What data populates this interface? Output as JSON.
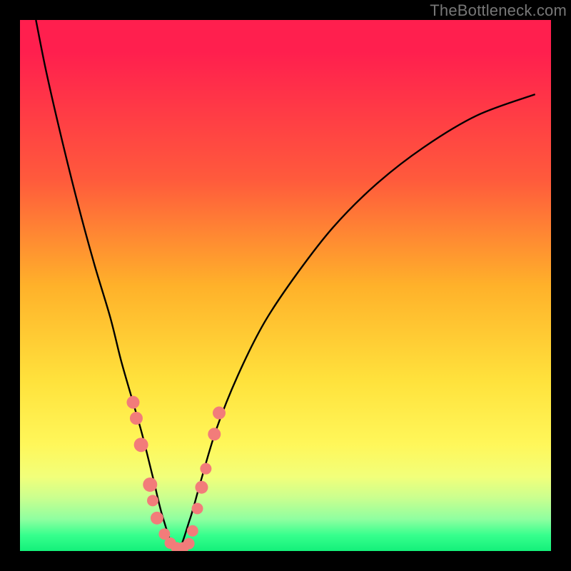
{
  "watermark": "TheBottleneck.com",
  "colors": {
    "frame": "#000000",
    "curve": "#000000",
    "marker": "#f27c7a",
    "marker_stroke": "#c95f5c"
  },
  "chart_data": {
    "type": "line",
    "title": "",
    "xlabel": "",
    "ylabel": "",
    "xlim": [
      0,
      100
    ],
    "ylim": [
      0,
      100
    ],
    "curve": {
      "comment": "approximate V-shaped bottleneck curve; x is horizontal % across plot, y is % bottleneck (100=top/red, 0=bottom/green)",
      "x": [
        3,
        5,
        8,
        11,
        14,
        17,
        19,
        21,
        23,
        25,
        27,
        29.5,
        32,
        34,
        37,
        41,
        46,
        52,
        59,
        67,
        76,
        86,
        97
      ],
      "y": [
        100,
        90,
        77,
        65,
        54,
        44,
        36,
        29,
        22,
        14,
        6,
        0,
        6,
        13,
        23,
        33,
        43,
        52,
        61,
        69,
        76,
        82,
        86
      ]
    },
    "markers": {
      "comment": "salmon dots overlaying the curve near the bottom; each item = [x%, y%, radius_px]",
      "points": [
        [
          21.3,
          28,
          9
        ],
        [
          21.9,
          25,
          9
        ],
        [
          22.8,
          20,
          10
        ],
        [
          24.5,
          12.5,
          10
        ],
        [
          25.0,
          9.5,
          8
        ],
        [
          25.8,
          6.2,
          9
        ],
        [
          27.2,
          3.2,
          8
        ],
        [
          28.3,
          1.5,
          8
        ],
        [
          29.5,
          0.6,
          8
        ],
        [
          30.7,
          0.6,
          8
        ],
        [
          31.8,
          1.4,
          8
        ],
        [
          32.5,
          3.8,
          8
        ],
        [
          33.4,
          8.0,
          8
        ],
        [
          34.2,
          12.0,
          9
        ],
        [
          35.0,
          15.5,
          8
        ],
        [
          36.6,
          22.0,
          9
        ],
        [
          37.5,
          26.0,
          9
        ]
      ]
    }
  }
}
